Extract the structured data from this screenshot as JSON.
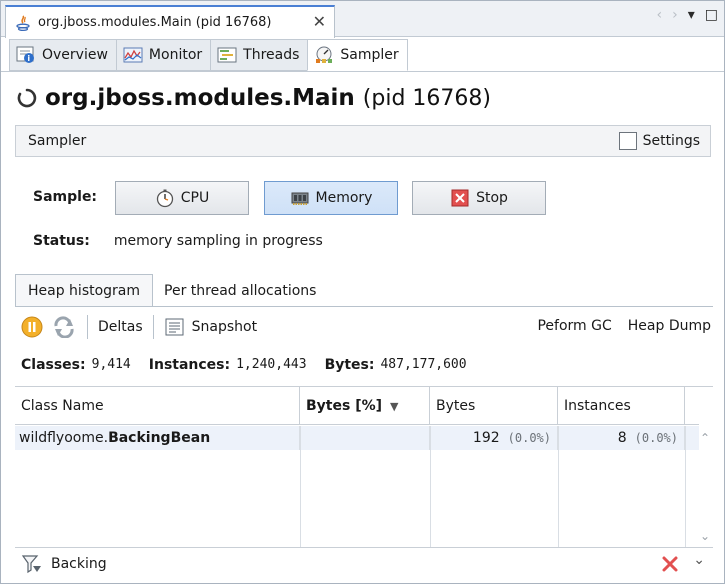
{
  "doc_tab": {
    "title": "org.jboss.modules.Main (pid 16768)",
    "close": "✕"
  },
  "strip_controls": {
    "prev": "‹",
    "next": "›",
    "menu": "▾",
    "restore": "□"
  },
  "view_tabs": [
    {
      "label": "Overview",
      "icon": "overview-icon"
    },
    {
      "label": "Monitor",
      "icon": "monitor-icon"
    },
    {
      "label": "Threads",
      "icon": "threads-icon"
    },
    {
      "label": "Sampler",
      "icon": "sampler-icon",
      "active": true
    }
  ],
  "headline": {
    "main": "org.jboss.modules.Main",
    "pid": "(pid 16768)"
  },
  "sampler_bar": {
    "title": "Sampler",
    "settings_label": "Settings",
    "settings_checked": false
  },
  "sample": {
    "label": "Sample:",
    "cpu": "CPU",
    "memory": "Memory",
    "stop": "Stop",
    "memory_pressed": true
  },
  "status": {
    "label": "Status:",
    "text": "memory sampling in progress"
  },
  "inner_tabs": [
    {
      "label": "Heap histogram",
      "active": true
    },
    {
      "label": "Per thread allocations"
    }
  ],
  "toolbar": {
    "deltas": "Deltas",
    "snapshot": "Snapshot",
    "gc": "Peform GC",
    "heap_dump": "Heap Dump"
  },
  "summary": {
    "classes_label": "Classes:",
    "classes": "9,414",
    "instances_label": "Instances:",
    "instances": "1,240,443",
    "bytes_label": "Bytes:",
    "bytes": "487,177,600"
  },
  "table": {
    "columns": [
      "Class Name",
      "Bytes [%]",
      "Bytes",
      "Instances"
    ],
    "sorted_column": "Bytes [%]",
    "rows": [
      {
        "class_prefix": "wildflyoome.",
        "class_name": "BackingBean",
        "bytes_pct": "",
        "bytes": "192",
        "bytes_share": "(0.0%)",
        "instances": "8",
        "instances_share": "(0.0%)"
      }
    ]
  },
  "filter": {
    "text": "Backing"
  },
  "colors": {
    "accent": "#4a7fd4",
    "row_highlight": "#edf2fa",
    "pressed_button": "#cfe1f7",
    "stop_red": "#e25050"
  }
}
